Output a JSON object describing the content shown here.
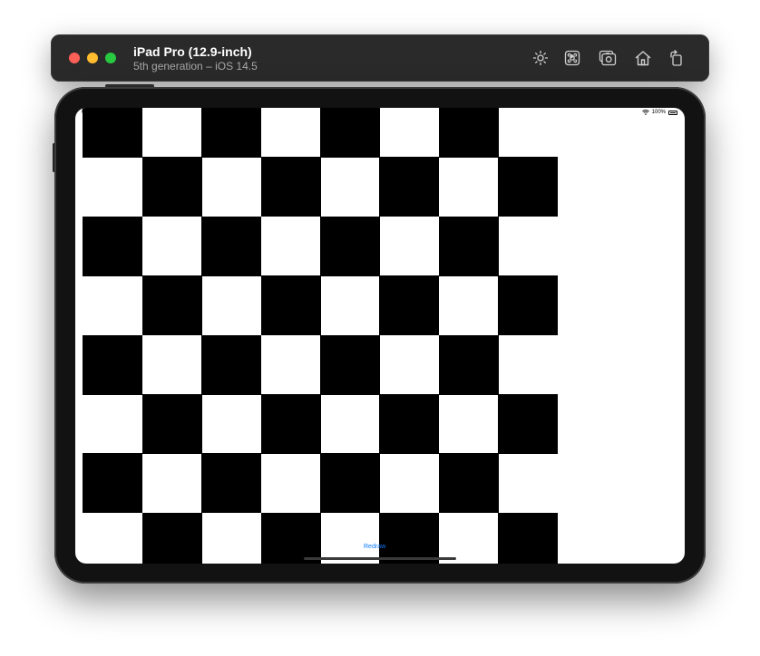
{
  "window": {
    "device_name": "iPad Pro (12.9-inch)",
    "device_subtitle": "5th generation – iOS 14.5",
    "toolbar_icons": [
      "brightness-icon",
      "command-icon",
      "screenshot-icon",
      "home-icon",
      "rotate-icon"
    ]
  },
  "status_bar": {
    "time_date": "6:02 PM   Sun Jul 4",
    "battery": "100%"
  },
  "board": {
    "black_cells": [
      [
        1,
        0
      ],
      [
        3,
        0
      ],
      [
        5,
        0
      ],
      [
        7,
        0
      ],
      [
        2,
        1
      ],
      [
        4,
        1
      ],
      [
        6,
        1
      ],
      [
        8,
        1
      ],
      [
        1,
        2
      ],
      [
        3,
        2
      ],
      [
        5,
        2
      ],
      [
        7,
        2
      ],
      [
        2,
        3
      ],
      [
        4,
        3
      ],
      [
        6,
        3
      ],
      [
        8,
        3
      ],
      [
        1,
        4
      ],
      [
        3,
        4
      ],
      [
        5,
        4
      ],
      [
        7,
        4
      ],
      [
        2,
        5
      ],
      [
        4,
        5
      ],
      [
        6,
        5
      ],
      [
        8,
        5
      ],
      [
        1,
        6
      ],
      [
        3,
        6
      ],
      [
        5,
        6
      ],
      [
        7,
        6
      ],
      [
        2,
        7
      ],
      [
        4,
        7
      ],
      [
        6,
        7
      ],
      [
        8,
        7
      ]
    ]
  },
  "app": {
    "redraw_label": "Redraw"
  },
  "colors": {
    "accent": "#0a7aff",
    "board_dark": "#000000",
    "board_light": "#ffffff"
  }
}
